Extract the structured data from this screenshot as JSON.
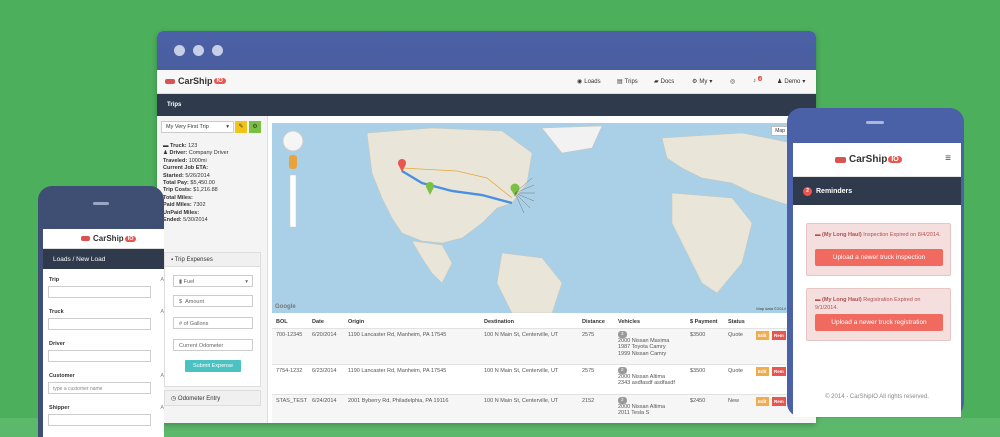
{
  "brand": {
    "name": "CarShip",
    "suffix": "IO"
  },
  "desktop": {
    "nav": [
      {
        "icon": "truck-icon",
        "label": "Loads"
      },
      {
        "icon": "road-icon",
        "label": "Trips"
      },
      {
        "icon": "folder-icon",
        "label": "Docs"
      },
      {
        "icon": "gear-icon",
        "label": "My"
      },
      {
        "icon": "help-icon",
        "label": ""
      },
      {
        "icon": "bell-icon",
        "label": "",
        "badge": "4"
      },
      {
        "icon": "user-icon",
        "label": "Demo"
      }
    ],
    "page_title": "Trips",
    "trip_select": "My Very First Trip",
    "trip_info": [
      {
        "label": "Truck:",
        "value": "123"
      },
      {
        "label": "Driver:",
        "value": "Company Driver"
      },
      {
        "label": "Traveled:",
        "value": "1000mi"
      },
      {
        "label": "Current Job ETA:",
        "value": ""
      },
      {
        "label": "Started:",
        "value": "5/26/2014"
      },
      {
        "label": "Total Pay:",
        "value": "$5,450.00"
      },
      {
        "label": "Trip Costs:",
        "value": "$1,216.88"
      },
      {
        "label": "Total Miles:",
        "value": ""
      },
      {
        "label": "Paid Miles:",
        "value": "7302"
      },
      {
        "label": "UnPaid Miles:",
        "value": ""
      },
      {
        "label": "Ended:",
        "value": "5/30/2014"
      }
    ],
    "expenses": {
      "title": "Trip Expenses",
      "type": "Fuel",
      "amount_placeholder": "Amount",
      "gallons_placeholder": "# of Gallons",
      "odometer_placeholder": "Current Odometer",
      "submit": "Submit Expense"
    },
    "odometer_title": "Odometer Entry",
    "map": {
      "type_button": "Map",
      "credit": "Map data ©2014 Google, INEGI",
      "logo": "Google"
    },
    "table": {
      "headers": [
        "BOL",
        "Date",
        "Origin",
        "Destination",
        "Distance",
        "Vehicles",
        "$ Payment",
        "Status"
      ],
      "rows": [
        {
          "bol": "700-12345",
          "date": "6/20/2014",
          "origin": "1190 Lancaster Rd, Manheim, PA 17545",
          "destination": "100 N Main St, Centerville, UT",
          "distance": "2575",
          "vehicle_count": "3",
          "vehicles": [
            "2000 Nissan Maxima",
            "1987 Toyota Camry",
            "1999 Nissan Camry"
          ],
          "payment": "$3500",
          "status": "Quote"
        },
        {
          "bol": "7754-1232",
          "date": "6/23/2014",
          "origin": "1190 Lancaster Rd, Manheim, PA 17545",
          "destination": "100 N Main St, Centerville, UT",
          "distance": "2575",
          "vehicle_count": "2",
          "vehicles": [
            "2000 Nissan Altima",
            "2343 asdfasdf asdfasdf"
          ],
          "payment": "$3500",
          "status": "Quote"
        },
        {
          "bol": "STAS_TEST",
          "date": "6/24/2014",
          "origin": "2001 Byberry Rd, Philadelphia, PA 19116",
          "destination": "100 N Main St, Centerville, UT",
          "distance": "2152",
          "vehicle_count": "2",
          "vehicles": [
            "2000 Nissan Altima",
            "2011 Tesla S"
          ],
          "payment": "$2450",
          "status": "New"
        }
      ],
      "edit_label": "Edit",
      "remove_label": "Rem"
    }
  },
  "phone_left": {
    "breadcrumb": "Loads  /  New Load",
    "fields": [
      {
        "label": "Trip",
        "extra": "A"
      },
      {
        "label": "Truck",
        "extra": "A"
      },
      {
        "label": "Driver",
        "extra": ""
      },
      {
        "label": "Customer",
        "extra": "A"
      },
      {
        "label": "Shipper",
        "extra": "A"
      }
    ],
    "customer_placeholder": "type a customer name"
  },
  "phone_right": {
    "reminders_count": "2",
    "reminders_title": "Reminders",
    "reminders": [
      {
        "prefix": "(My Long Haul)",
        "text": "Inspection Expired on 8/4/2014.",
        "button": "Upload a newer truck inspection"
      },
      {
        "prefix": "(My Long Haul)",
        "text": "Registration Expired on 9/1/2014.",
        "button": "Upload a newer truck registration"
      }
    ],
    "footer": "© 2014 - CarShipIO All rights reserved."
  },
  "colors": {
    "background": "#4caf5c",
    "chrome": "#4b61a7",
    "dark": "#2f3b4c",
    "accent": "#e8564f",
    "teal": "#4cc1c1"
  }
}
